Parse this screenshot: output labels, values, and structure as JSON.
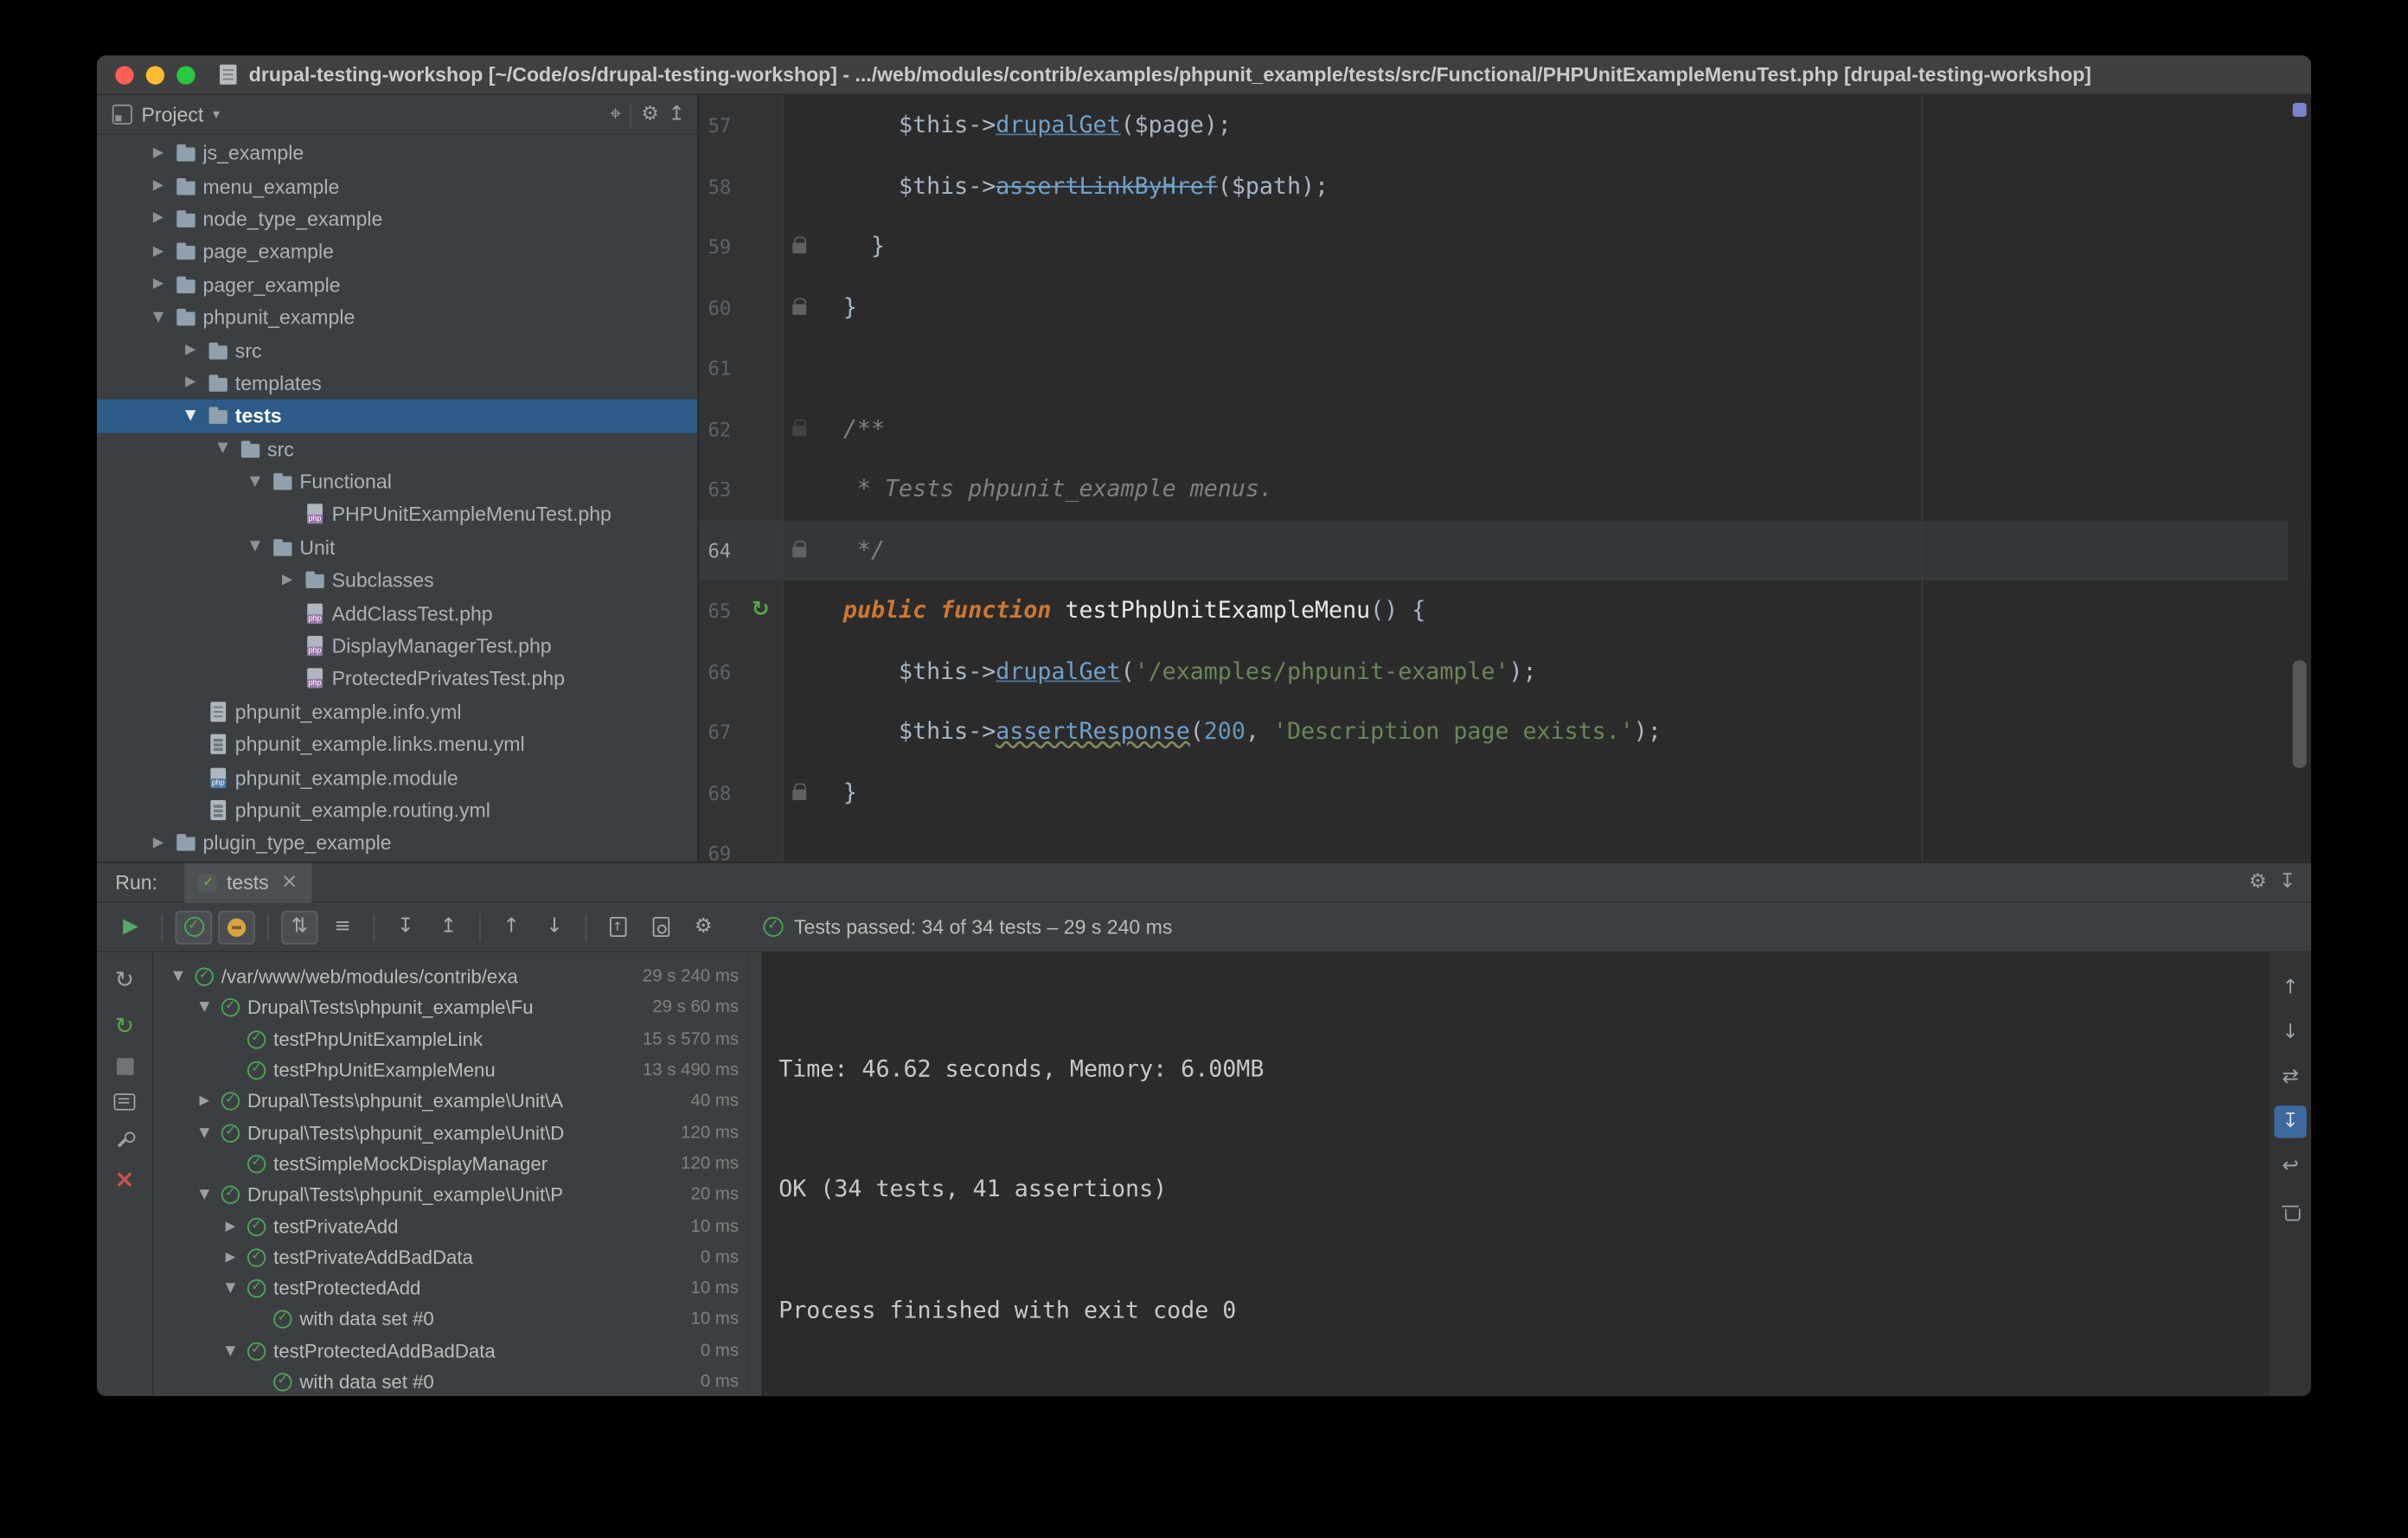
{
  "window": {
    "title": "drupal-testing-workshop [~/Code/os/drupal-testing-workshop] - .../web/modules/contrib/examples/phpunit_example/tests/src/Functional/PHPUnitExampleMenuTest.php [drupal-testing-workshop]"
  },
  "colors": {
    "selection_blue": "#2D5B87",
    "pass_green": "#4FA75A",
    "run_green": "#59A869",
    "keyword_orange": "#CC7832",
    "string_green": "#6A8759",
    "number_blue": "#6897BB",
    "method_blue": "#72A0C9",
    "error_stripe_mark": "#7986CB",
    "close_red": "#C75450",
    "editor_bg": "#2B2B2B",
    "panel_bg": "#3C3F41"
  },
  "icons": {
    "chevron_down": "▼",
    "chevron_right": "▶",
    "caret_down": "▾",
    "play": "▶",
    "check": "✓",
    "gear": "⚙",
    "target": "⌖",
    "collapse_all": "↥",
    "expand_all": "↧",
    "up": "↑",
    "down": "↓",
    "swap": "⇄",
    "softwrap": "↩",
    "close": "×",
    "sort": "⇅",
    "lines": "≡",
    "circular": "↻",
    "hide": "↧"
  },
  "project": {
    "header_label": "Project",
    "tree": [
      {
        "indent": 1,
        "arrow": "r",
        "icon": "folder",
        "label": "js_example"
      },
      {
        "indent": 1,
        "arrow": "r",
        "icon": "folder",
        "label": "menu_example"
      },
      {
        "indent": 1,
        "arrow": "r",
        "icon": "folder",
        "label": "node_type_example"
      },
      {
        "indent": 1,
        "arrow": "r",
        "icon": "folder",
        "label": "page_example"
      },
      {
        "indent": 1,
        "arrow": "r",
        "icon": "folder",
        "label": "pager_example"
      },
      {
        "indent": 1,
        "arrow": "d",
        "icon": "folder",
        "label": "phpunit_example"
      },
      {
        "indent": 2,
        "arrow": "r",
        "icon": "folder",
        "label": "src"
      },
      {
        "indent": 2,
        "arrow": "r",
        "icon": "folder",
        "label": "templates"
      },
      {
        "indent": 2,
        "arrow": "d",
        "icon": "folder",
        "label": "tests",
        "selected": true
      },
      {
        "indent": 3,
        "arrow": "d",
        "icon": "folder",
        "label": "src"
      },
      {
        "indent": 4,
        "arrow": "d",
        "icon": "folder",
        "label": "Functional"
      },
      {
        "indent": 5,
        "arrow": null,
        "icon": "php",
        "label": "PHPUnitExampleMenuTest.php"
      },
      {
        "indent": 4,
        "arrow": "d",
        "icon": "folder",
        "label": "Unit"
      },
      {
        "indent": 5,
        "arrow": "r",
        "icon": "folder",
        "label": "Subclasses"
      },
      {
        "indent": 5,
        "arrow": null,
        "icon": "php",
        "label": "AddClassTest.php"
      },
      {
        "indent": 5,
        "arrow": null,
        "icon": "php",
        "label": "DisplayManagerTest.php"
      },
      {
        "indent": 5,
        "arrow": null,
        "icon": "php",
        "label": "ProtectedPrivatesTest.php"
      },
      {
        "indent": 2,
        "arrow": null,
        "icon": "yml",
        "label": "phpunit_example.info.yml"
      },
      {
        "indent": 2,
        "arrow": null,
        "icon": "yml",
        "label": "phpunit_example.links.menu.yml"
      },
      {
        "indent": 2,
        "arrow": null,
        "icon": "module",
        "label": "phpunit_example.module"
      },
      {
        "indent": 2,
        "arrow": null,
        "icon": "yml",
        "label": "phpunit_example.routing.yml"
      },
      {
        "indent": 1,
        "arrow": "r",
        "icon": "folder",
        "label": "plugin_type_example"
      }
    ]
  },
  "editor": {
    "lines": [
      {
        "num": "57",
        "segs": [
          [
            "d",
            "      $this->"
          ],
          [
            "mu",
            "drupalGet"
          ],
          [
            "d",
            "($page);"
          ]
        ]
      },
      {
        "num": "58",
        "segs": [
          [
            "d",
            "      $this->"
          ],
          [
            "ms",
            "assertLinkByHref"
          ],
          [
            "d",
            "($path);"
          ]
        ]
      },
      {
        "num": "59",
        "gut": "lock",
        "segs": [
          [
            "d",
            "    }"
          ]
        ]
      },
      {
        "num": "60",
        "gut": "lock",
        "segs": [
          [
            "d",
            "  }"
          ]
        ]
      },
      {
        "num": "61",
        "segs": []
      },
      {
        "num": "62",
        "gut": "lockf",
        "segs": [
          [
            "c",
            "  /**"
          ]
        ]
      },
      {
        "num": "63",
        "segs": [
          [
            "c",
            "   * Tests phpunit_example menus."
          ]
        ]
      },
      {
        "num": "64",
        "gut": "lock",
        "caret": true,
        "segs": [
          [
            "c",
            "   */"
          ]
        ]
      },
      {
        "num": "65",
        "gut": "run",
        "segs": [
          [
            "d",
            "  "
          ],
          [
            "k",
            "public"
          ],
          [
            "d",
            " "
          ],
          [
            "k",
            "function"
          ],
          [
            "d",
            " "
          ],
          [
            "fn",
            "testPhpUnitExampleMenu"
          ],
          [
            "d",
            "() {"
          ]
        ]
      },
      {
        "num": "66",
        "segs": [
          [
            "d",
            "      $this->"
          ],
          [
            "mu",
            "drupalGet"
          ],
          [
            "d",
            "("
          ],
          [
            "s",
            "'/examples/phpunit-example'"
          ],
          [
            "d",
            ");"
          ]
        ]
      },
      {
        "num": "67",
        "segs": [
          [
            "d",
            "      $this->"
          ],
          [
            "mw",
            "assertResponse"
          ],
          [
            "d",
            "("
          ],
          [
            "n",
            "200"
          ],
          [
            "d",
            ", "
          ],
          [
            "s",
            "'Description page exists.'"
          ],
          [
            "d",
            ");"
          ]
        ]
      },
      {
        "num": "68",
        "gut": "lock",
        "segs": [
          [
            "d",
            "  }"
          ]
        ]
      },
      {
        "num": "69",
        "segs": []
      }
    ]
  },
  "run": {
    "label": "Run:",
    "tab_label": "tests",
    "status": "Tests passed: 34 of 34 tests – 29 s 240 ms",
    "tree": [
      {
        "indent": 0,
        "arrow": "d",
        "label": "/var/www/web/modules/contrib/exa",
        "time": "29 s 240 ms"
      },
      {
        "indent": 1,
        "arrow": "d",
        "label": "Drupal\\Tests\\phpunit_example\\Fu",
        "time": "29 s 60 ms"
      },
      {
        "indent": 2,
        "arrow": null,
        "label": "testPhpUnitExampleLink",
        "time": "15 s 570 ms"
      },
      {
        "indent": 2,
        "arrow": null,
        "label": "testPhpUnitExampleMenu",
        "time": "13 s 490 ms"
      },
      {
        "indent": 1,
        "arrow": "r",
        "label": "Drupal\\Tests\\phpunit_example\\Unit\\A",
        "time": "40 ms"
      },
      {
        "indent": 1,
        "arrow": "d",
        "label": "Drupal\\Tests\\phpunit_example\\Unit\\D",
        "time": "120 ms"
      },
      {
        "indent": 2,
        "arrow": null,
        "label": "testSimpleMockDisplayManager",
        "time": "120 ms"
      },
      {
        "indent": 1,
        "arrow": "d",
        "label": "Drupal\\Tests\\phpunit_example\\Unit\\P",
        "time": "20 ms"
      },
      {
        "indent": 2,
        "arrow": "r",
        "label": "testPrivateAdd",
        "time": "10 ms"
      },
      {
        "indent": 2,
        "arrow": "r",
        "label": "testPrivateAddBadData",
        "time": "0 ms"
      },
      {
        "indent": 2,
        "arrow": "d",
        "label": "testProtectedAdd",
        "time": "10 ms"
      },
      {
        "indent": 3,
        "arrow": null,
        "label": "with data set #0",
        "time": "10 ms"
      },
      {
        "indent": 2,
        "arrow": "d",
        "label": "testProtectedAddBadData",
        "time": "0 ms"
      },
      {
        "indent": 3,
        "arrow": null,
        "label": "with data set #0",
        "time": "0 ms"
      }
    ],
    "console": [
      "Time: 46.62 seconds, Memory: 6.00MB",
      "OK (34 tests, 41 assertions)",
      "Process finished with exit code 0"
    ]
  }
}
